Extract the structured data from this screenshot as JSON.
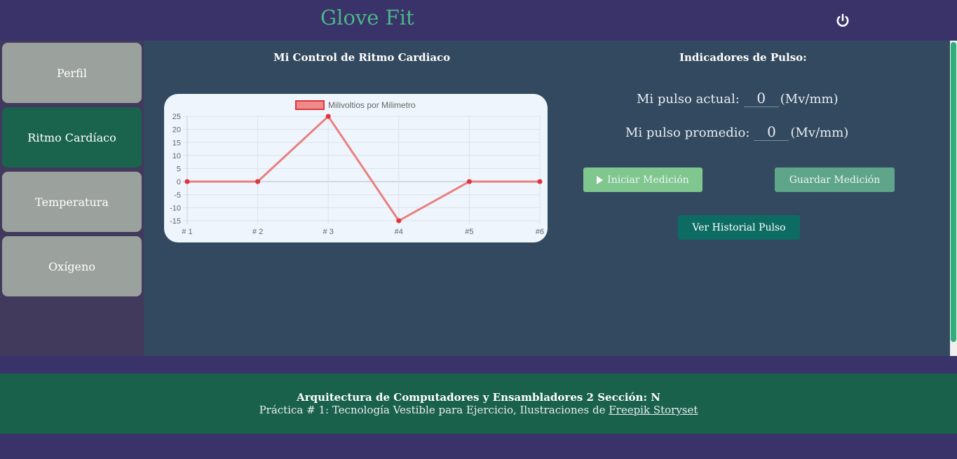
{
  "header": {
    "brand": "Glove Fit",
    "power_icon": "power-icon"
  },
  "sidebar": {
    "items": [
      {
        "label": "Perfil",
        "active": false
      },
      {
        "label": "Ritmo Cardíaco",
        "active": true
      },
      {
        "label": "Temperatura",
        "active": false
      },
      {
        "label": "Oxígeno",
        "active": false
      }
    ]
  },
  "main": {
    "chart_title": "Mi Control de Ritmo Cardiaco",
    "indicators_title": "Indicadores de Pulso:",
    "pulse_current_label": "Mi pulso actual:",
    "pulse_current_value": "0",
    "pulse_current_unit": "(Mv/mm)",
    "pulse_avg_label": "Mi pulso promedio:",
    "pulse_avg_value": "0",
    "pulse_avg_unit": "(Mv/mm)",
    "btn_start": "Iniciar Medición",
    "btn_save": "Guardar Medición",
    "btn_history": "Ver Historial Pulso"
  },
  "chart_data": {
    "type": "line",
    "categories": [
      "# 1",
      "# 2",
      "# 3",
      "#4",
      "#5",
      "#6"
    ],
    "series": [
      {
        "name": "Milivoltios por Milimetro",
        "values": [
          0,
          0,
          25,
          -15,
          0,
          0
        ],
        "color": "#e98080",
        "point_color": "#e0343c"
      }
    ],
    "yticks": [
      25,
      20,
      15,
      10,
      5,
      0,
      -5,
      -10,
      -15
    ],
    "ylim": [
      -15,
      25
    ],
    "grid": true,
    "legend": "top"
  },
  "footer": {
    "line1": "Arquitectura de Computadores y Ensambladores 2 Sección: N",
    "line2_prefix": "Práctica # 1: Tecnología Vestible para Ejercicio, Ilustraciones de",
    "link_text": "Freepik Storyset"
  },
  "colors": {
    "brand": "#4bb587",
    "active_nav": "#1a644e",
    "nav": "#9ba19d",
    "main_bg": "#33495f",
    "footer_bg": "#1a614b"
  }
}
